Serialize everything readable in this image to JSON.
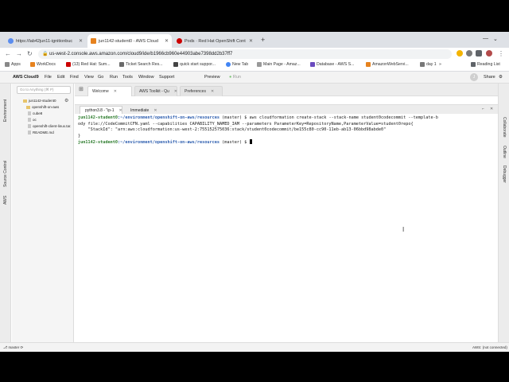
{
  "browser": {
    "tabs": [
      {
        "label": "https://lab42jun11-ignitionbuc",
        "favicon_color": "#5b8def"
      },
      {
        "label": "jun1142-student0 - AWS Cloud",
        "favicon_color": "#e6821e"
      },
      {
        "label": "Pods · Red Hat OpenShift Cont",
        "favicon_color": "#cc0000"
      }
    ],
    "url": "us-west-2.console.aws.amazon.com/cloud9/ide/b1966cb960e44903abe7398dd2b37ff7",
    "bookmarks": [
      {
        "label": "Apps",
        "color": "#888888"
      },
      {
        "label": "WorkDocs",
        "color": "#e6821e"
      },
      {
        "label": "(13) Red Hat: Sum...",
        "color": "#cc0000"
      },
      {
        "label": "Ticket Search Res...",
        "color": "#6a6a6a"
      },
      {
        "label": "quick start suppor...",
        "color": "#444444"
      },
      {
        "label": "New Tab",
        "color": "#4285f4"
      },
      {
        "label": "Main Page - Amaz...",
        "color": "#999999"
      },
      {
        "label": "Database - AWS S...",
        "color": "#6a4bbf"
      },
      {
        "label": "AmazonWebServi...",
        "color": "#e6821e"
      },
      {
        "label": "day 1",
        "color": "#777777"
      }
    ],
    "reading_list": "Reading List"
  },
  "c9": {
    "brand": "AWS Cloud9",
    "menu": [
      "File",
      "Edit",
      "Find",
      "View",
      "Go",
      "Run",
      "Tools",
      "Window",
      "Support"
    ],
    "preview": "Preview",
    "run": "Run",
    "share": "Share",
    "avatar_letter": "J",
    "left_rail": [
      "Environment",
      "Source Control",
      "AWS"
    ],
    "right_rail": [
      "Collaborate",
      "Outline",
      "Debugger"
    ]
  },
  "tree": {
    "search_placeholder": "Go to Anything (⌘ P)",
    "root": "jun1142-student0",
    "items": [
      "openshift-on-aws",
      "cube8",
      "oc",
      "openshift-client-linux.tar.",
      "README.md"
    ]
  },
  "editor_tabs": [
    "Welcome",
    "AWS Toolkit - Qu",
    "Preferences"
  ],
  "terminal_tabs": [
    "python3.8 - \"ip-1",
    "Immediate"
  ],
  "terminal": {
    "user": "jun1142-student0",
    "path": ":~/environment/openshift-on-aws/resources",
    "branch": " (master) $ ",
    "command_1": "aws cloudformation create-stack --stack-name student0codecommit --template-b",
    "command_2": "ody file://CodeCommitCFN.yaml --capabilities CAPABILITY_NAMED_IAM --parameters ParameterKey=RepositoryName,ParameterValue=student0repo{",
    "output_1": "    \"StackId\": \"arn:aws:cloudformation:us-west-2:755152575036:stack/student0codecommit/be155c80-cc90-11eb-ab13-06bbd98abde0\"",
    "output_2": "}"
  },
  "status": {
    "left": "master",
    "right": "AWS: (not connected)"
  }
}
